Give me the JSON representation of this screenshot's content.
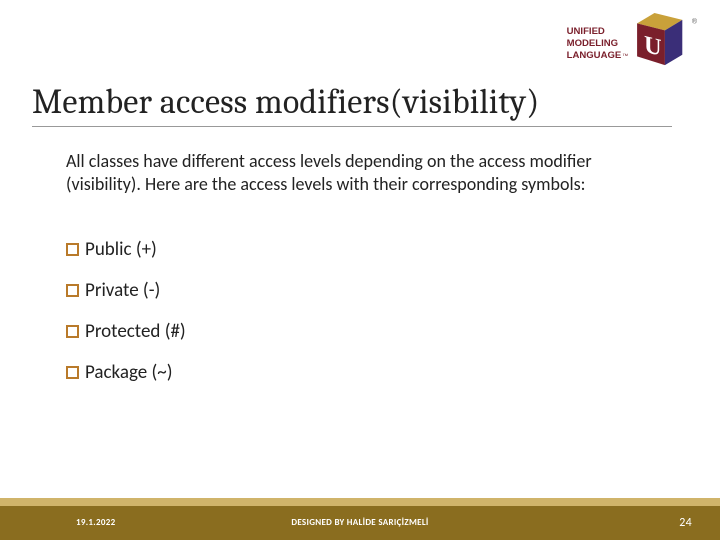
{
  "logo": {
    "line1": "UNIFIED",
    "line2": "MODELING",
    "line3": "LANGUAGE",
    "tm": "™",
    "reg": "®",
    "u_letter": "U",
    "name": "uml-logo"
  },
  "heading": "Member access modifiers(visibility)",
  "body": "All classes have different access levels depending on the access modifier (visibility). Here are the access levels with their corresponding symbols:",
  "bullets": [
    {
      "label": "Public (+)"
    },
    {
      "label": "Private (-)"
    },
    {
      "label": "Protected (#)"
    },
    {
      "label": "Package (~)"
    }
  ],
  "footer": {
    "date": "19.1.2022",
    "center": "DESIGNED BY HALİDE SARIÇİZMELİ",
    "page": "24"
  },
  "colors": {
    "bullet_border": "#b97a2a",
    "footer_dark": "#8a6d1f",
    "footer_light": "#d0b46a",
    "logo_maroon": "#7a1f2b",
    "logo_gold": "#c9a13a",
    "logo_purple": "#3a2e78"
  }
}
